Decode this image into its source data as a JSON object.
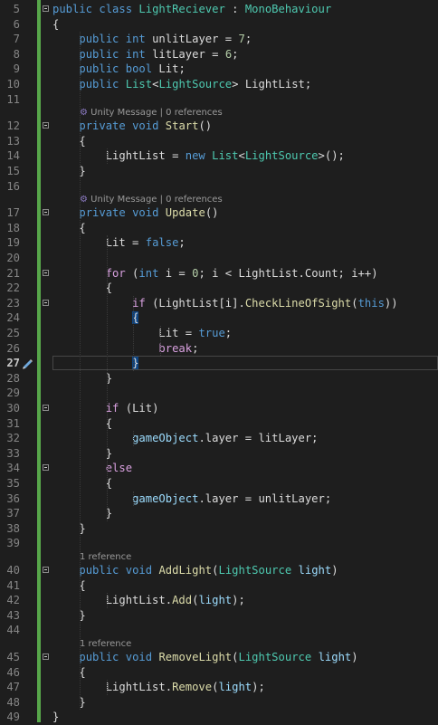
{
  "editor": {
    "current_line": "27",
    "lines": [
      {
        "no": "5",
        "tokens": [
          {
            "t": "public",
            "c": "k"
          },
          {
            "t": " "
          },
          {
            "t": "class",
            "c": "k"
          },
          {
            "t": " "
          },
          {
            "t": "LightReciever",
            "c": "t"
          },
          {
            "t": " : "
          },
          {
            "t": "MonoBehaviour",
            "c": "t"
          }
        ]
      },
      {
        "no": "6",
        "tokens": [
          {
            "t": "{"
          }
        ]
      },
      {
        "no": "7",
        "tokens": [
          {
            "t": "    "
          },
          {
            "t": "public",
            "c": "k"
          },
          {
            "t": " "
          },
          {
            "t": "int",
            "c": "k"
          },
          {
            "t": " unlitLayer = "
          },
          {
            "t": "7",
            "c": "n"
          },
          {
            "t": ";"
          }
        ]
      },
      {
        "no": "8",
        "tokens": [
          {
            "t": "    "
          },
          {
            "t": "public",
            "c": "k"
          },
          {
            "t": " "
          },
          {
            "t": "int",
            "c": "k"
          },
          {
            "t": " litLayer = "
          },
          {
            "t": "6",
            "c": "n"
          },
          {
            "t": ";"
          }
        ]
      },
      {
        "no": "9",
        "tokens": [
          {
            "t": "    "
          },
          {
            "t": "public",
            "c": "k"
          },
          {
            "t": " "
          },
          {
            "t": "bool",
            "c": "k"
          },
          {
            "t": " Lit;"
          }
        ]
      },
      {
        "no": "10",
        "tokens": [
          {
            "t": "    "
          },
          {
            "t": "public",
            "c": "k"
          },
          {
            "t": " "
          },
          {
            "t": "List",
            "c": "t"
          },
          {
            "t": "<"
          },
          {
            "t": "LightSource",
            "c": "t"
          },
          {
            "t": "> LightList;"
          }
        ]
      },
      {
        "no": "11",
        "tokens": []
      },
      {
        "no": "12",
        "lens": "Unity Message | 0 references",
        "lens_icon": true,
        "tokens": [
          {
            "t": "    "
          },
          {
            "t": "private",
            "c": "k"
          },
          {
            "t": " "
          },
          {
            "t": "void",
            "c": "k"
          },
          {
            "t": " "
          },
          {
            "t": "Start",
            "c": "m"
          },
          {
            "t": "()"
          }
        ]
      },
      {
        "no": "13",
        "tokens": [
          {
            "t": "    {"
          }
        ]
      },
      {
        "no": "14",
        "tokens": [
          {
            "t": "        LightList = "
          },
          {
            "t": "new",
            "c": "k"
          },
          {
            "t": " "
          },
          {
            "t": "List",
            "c": "t"
          },
          {
            "t": "<"
          },
          {
            "t": "LightSource",
            "c": "t"
          },
          {
            "t": ">();"
          }
        ]
      },
      {
        "no": "15",
        "tokens": [
          {
            "t": "    }"
          }
        ]
      },
      {
        "no": "16",
        "tokens": []
      },
      {
        "no": "17",
        "lens": "Unity Message | 0 references",
        "lens_icon": true,
        "tokens": [
          {
            "t": "    "
          },
          {
            "t": "private",
            "c": "k"
          },
          {
            "t": " "
          },
          {
            "t": "void",
            "c": "k"
          },
          {
            "t": " "
          },
          {
            "t": "Update",
            "c": "m"
          },
          {
            "t": "()"
          }
        ]
      },
      {
        "no": "18",
        "tokens": [
          {
            "t": "    {"
          }
        ]
      },
      {
        "no": "19",
        "tokens": [
          {
            "t": "        Lit = "
          },
          {
            "t": "false",
            "c": "k"
          },
          {
            "t": ";"
          }
        ]
      },
      {
        "no": "20",
        "tokens": []
      },
      {
        "no": "21",
        "tokens": [
          {
            "t": "        "
          },
          {
            "t": "for",
            "c": "c"
          },
          {
            "t": " ("
          },
          {
            "t": "int",
            "c": "k"
          },
          {
            "t": " i = "
          },
          {
            "t": "0",
            "c": "n"
          },
          {
            "t": "; i < LightList.Count; i++)"
          }
        ]
      },
      {
        "no": "22",
        "tokens": [
          {
            "t": "        {"
          }
        ]
      },
      {
        "no": "23",
        "tokens": [
          {
            "t": "            "
          },
          {
            "t": "if",
            "c": "c"
          },
          {
            "t": " (LightList[i]."
          },
          {
            "t": "CheckLineOfSight",
            "c": "m"
          },
          {
            "t": "("
          },
          {
            "t": "this",
            "c": "k"
          },
          {
            "t": "))"
          }
        ]
      },
      {
        "no": "24",
        "tokens": [
          {
            "t": "            "
          },
          {
            "t": "{",
            "c": "bh"
          }
        ]
      },
      {
        "no": "25",
        "tokens": [
          {
            "t": "                Lit = "
          },
          {
            "t": "true",
            "c": "k"
          },
          {
            "t": ";"
          }
        ]
      },
      {
        "no": "26",
        "tokens": [
          {
            "t": "                "
          },
          {
            "t": "break",
            "c": "c"
          },
          {
            "t": ";"
          }
        ]
      },
      {
        "no": "27",
        "tokens": [
          {
            "t": "            "
          },
          {
            "t": "}",
            "c": "bh"
          }
        ]
      },
      {
        "no": "28",
        "tokens": [
          {
            "t": "        }"
          }
        ]
      },
      {
        "no": "29",
        "tokens": []
      },
      {
        "no": "30",
        "tokens": [
          {
            "t": "        "
          },
          {
            "t": "if",
            "c": "c"
          },
          {
            "t": " (Lit)"
          }
        ]
      },
      {
        "no": "31",
        "tokens": [
          {
            "t": "        {"
          }
        ]
      },
      {
        "no": "32",
        "tokens": [
          {
            "t": "            "
          },
          {
            "t": "gameObject",
            "c": "p"
          },
          {
            "t": ".layer = litLayer;"
          }
        ]
      },
      {
        "no": "33",
        "tokens": [
          {
            "t": "        }"
          }
        ]
      },
      {
        "no": "34",
        "tokens": [
          {
            "t": "        "
          },
          {
            "t": "else",
            "c": "c"
          }
        ]
      },
      {
        "no": "35",
        "tokens": [
          {
            "t": "        {"
          }
        ]
      },
      {
        "no": "36",
        "tokens": [
          {
            "t": "            "
          },
          {
            "t": "gameObject",
            "c": "p"
          },
          {
            "t": ".layer = unlitLayer;"
          }
        ]
      },
      {
        "no": "37",
        "tokens": [
          {
            "t": "        }"
          }
        ]
      },
      {
        "no": "38",
        "tokens": [
          {
            "t": "    }"
          }
        ]
      },
      {
        "no": "39",
        "tokens": []
      },
      {
        "no": "40",
        "lens": "1 reference",
        "tokens": [
          {
            "t": "    "
          },
          {
            "t": "public",
            "c": "k"
          },
          {
            "t": " "
          },
          {
            "t": "void",
            "c": "k"
          },
          {
            "t": " "
          },
          {
            "t": "AddLight",
            "c": "m"
          },
          {
            "t": "("
          },
          {
            "t": "LightSource",
            "c": "t"
          },
          {
            "t": " "
          },
          {
            "t": "light",
            "c": "p"
          },
          {
            "t": ")"
          }
        ]
      },
      {
        "no": "41",
        "tokens": [
          {
            "t": "    {"
          }
        ]
      },
      {
        "no": "42",
        "tokens": [
          {
            "t": "        LightList."
          },
          {
            "t": "Add",
            "c": "m"
          },
          {
            "t": "("
          },
          {
            "t": "light",
            "c": "p"
          },
          {
            "t": ");"
          }
        ]
      },
      {
        "no": "43",
        "tokens": [
          {
            "t": "    }"
          }
        ]
      },
      {
        "no": "44",
        "tokens": []
      },
      {
        "no": "45",
        "lens": "1 reference",
        "tokens": [
          {
            "t": "    "
          },
          {
            "t": "public",
            "c": "k"
          },
          {
            "t": " "
          },
          {
            "t": "void",
            "c": "k"
          },
          {
            "t": " "
          },
          {
            "t": "RemoveLight",
            "c": "m"
          },
          {
            "t": "("
          },
          {
            "t": "LightSource",
            "c": "t"
          },
          {
            "t": " "
          },
          {
            "t": "light",
            "c": "p"
          },
          {
            "t": ")"
          }
        ]
      },
      {
        "no": "46",
        "tokens": [
          {
            "t": "    {"
          }
        ]
      },
      {
        "no": "47",
        "tokens": [
          {
            "t": "        LightList."
          },
          {
            "t": "Remove",
            "c": "m"
          },
          {
            "t": "("
          },
          {
            "t": "light",
            "c": "p"
          },
          {
            "t": ");"
          }
        ]
      },
      {
        "no": "48",
        "tokens": [
          {
            "t": "    }"
          }
        ]
      },
      {
        "no": "49",
        "tokens": [
          {
            "t": "}"
          }
        ]
      }
    ]
  },
  "colors": {
    "background": "#1e1e1e",
    "keyword": "#569cd6",
    "control_keyword": "#d8a0df",
    "type": "#4ec9b0",
    "method": "#dcdcaa",
    "number": "#b5cea8",
    "parameter": "#9cdcfe",
    "text": "#dcdcdc",
    "line_number": "#858585",
    "change_bar": "#57a64a"
  },
  "icons": {
    "lens_icon": "unity-message-icon",
    "gutter_icon": "pencil-icon"
  }
}
